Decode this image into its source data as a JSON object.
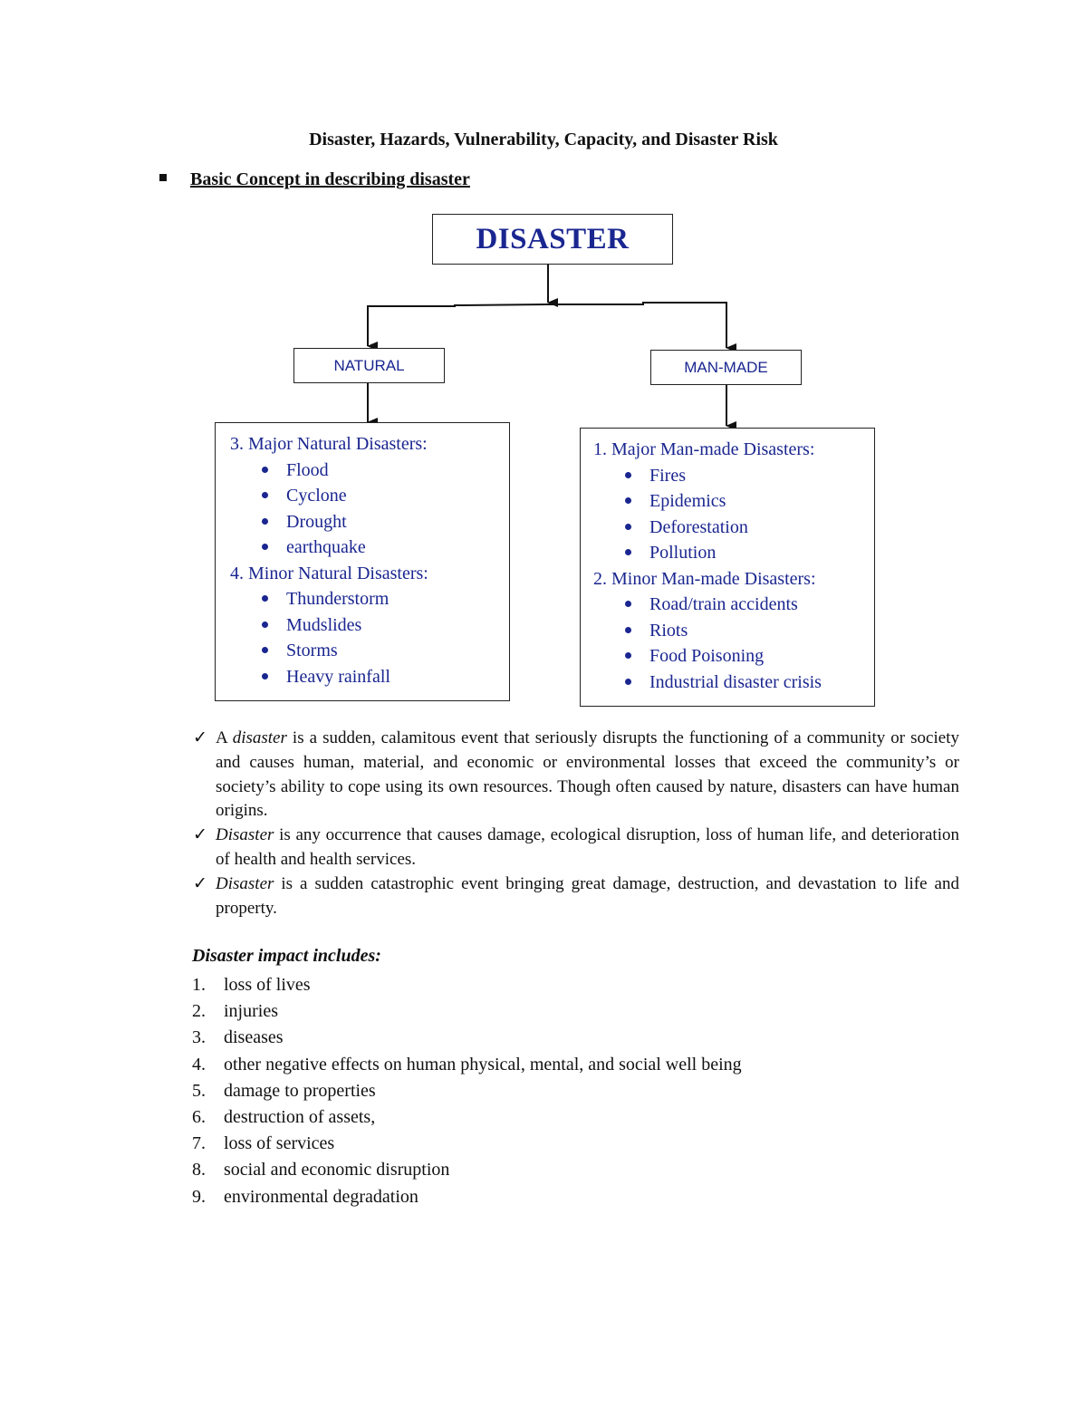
{
  "document": {
    "title": "Disaster, Hazards, Vulnerability, Capacity, and Disaster Risk",
    "section_heading": "Basic Concept in describing disaster"
  },
  "diagram": {
    "root": "DISASTER",
    "categories": [
      {
        "label": "NATURAL",
        "groups": [
          {
            "heading": "3. Major Natural Disasters:",
            "items": [
              "Flood",
              "Cyclone",
              "Drought",
              "earthquake"
            ]
          },
          {
            "heading": "4. Minor Natural Disasters:",
            "items": [
              "Thunderstorm",
              "Mudslides",
              "Storms",
              "Heavy rainfall"
            ]
          }
        ]
      },
      {
        "label": "MAN-MADE",
        "groups": [
          {
            "heading": "1. Major Man-made Disasters:",
            "items": [
              "Fires",
              "Epidemics",
              "Deforestation",
              "Pollution"
            ]
          },
          {
            "heading": "2. Minor Man-made Disasters:",
            "items": [
              "Road/train accidents",
              "Riots",
              "Food Poisoning",
              "Industrial disaster crisis"
            ]
          }
        ]
      }
    ],
    "colors": {
      "text_blue": "#1a2690",
      "line": "#111111"
    }
  },
  "definitions": [
    {
      "check": "✓",
      "lead": "A ",
      "term": "disaster",
      "rest": " is a sudden, calamitous event that seriously disrupts the functioning of a community or society and causes human, material, and economic or environmental losses that exceed the community’s or society’s ability to cope using its own resources. Though often caused by nature, disasters can have human origins."
    },
    {
      "check": "✓",
      "lead": "",
      "term": "Disaster",
      "rest": " is any occurrence that causes damage, ecological disruption, loss of human life, and deterioration of health and health services."
    },
    {
      "check": "✓",
      "lead": "",
      "term": "Disaster",
      "rest": " is a sudden catastrophic event bringing great damage, destruction, and devastation to life and property."
    }
  ],
  "impact": {
    "title": "Disaster impact includes:",
    "items": [
      {
        "num": "1.",
        "text": "loss of lives"
      },
      {
        "num": "2.",
        "text": "injuries"
      },
      {
        "num": "3.",
        "text": "diseases"
      },
      {
        "num": "4.",
        "text": "other negative effects on human physical, mental, and social well being"
      },
      {
        "num": "5.",
        "text": "damage to properties"
      },
      {
        "num": "6.",
        "text": "destruction of assets,"
      },
      {
        "num": "7.",
        "text": "loss of services"
      },
      {
        "num": "8.",
        "text": "social and economic disruption"
      },
      {
        "num": "9.",
        "text": "environmental degradation"
      }
    ]
  }
}
